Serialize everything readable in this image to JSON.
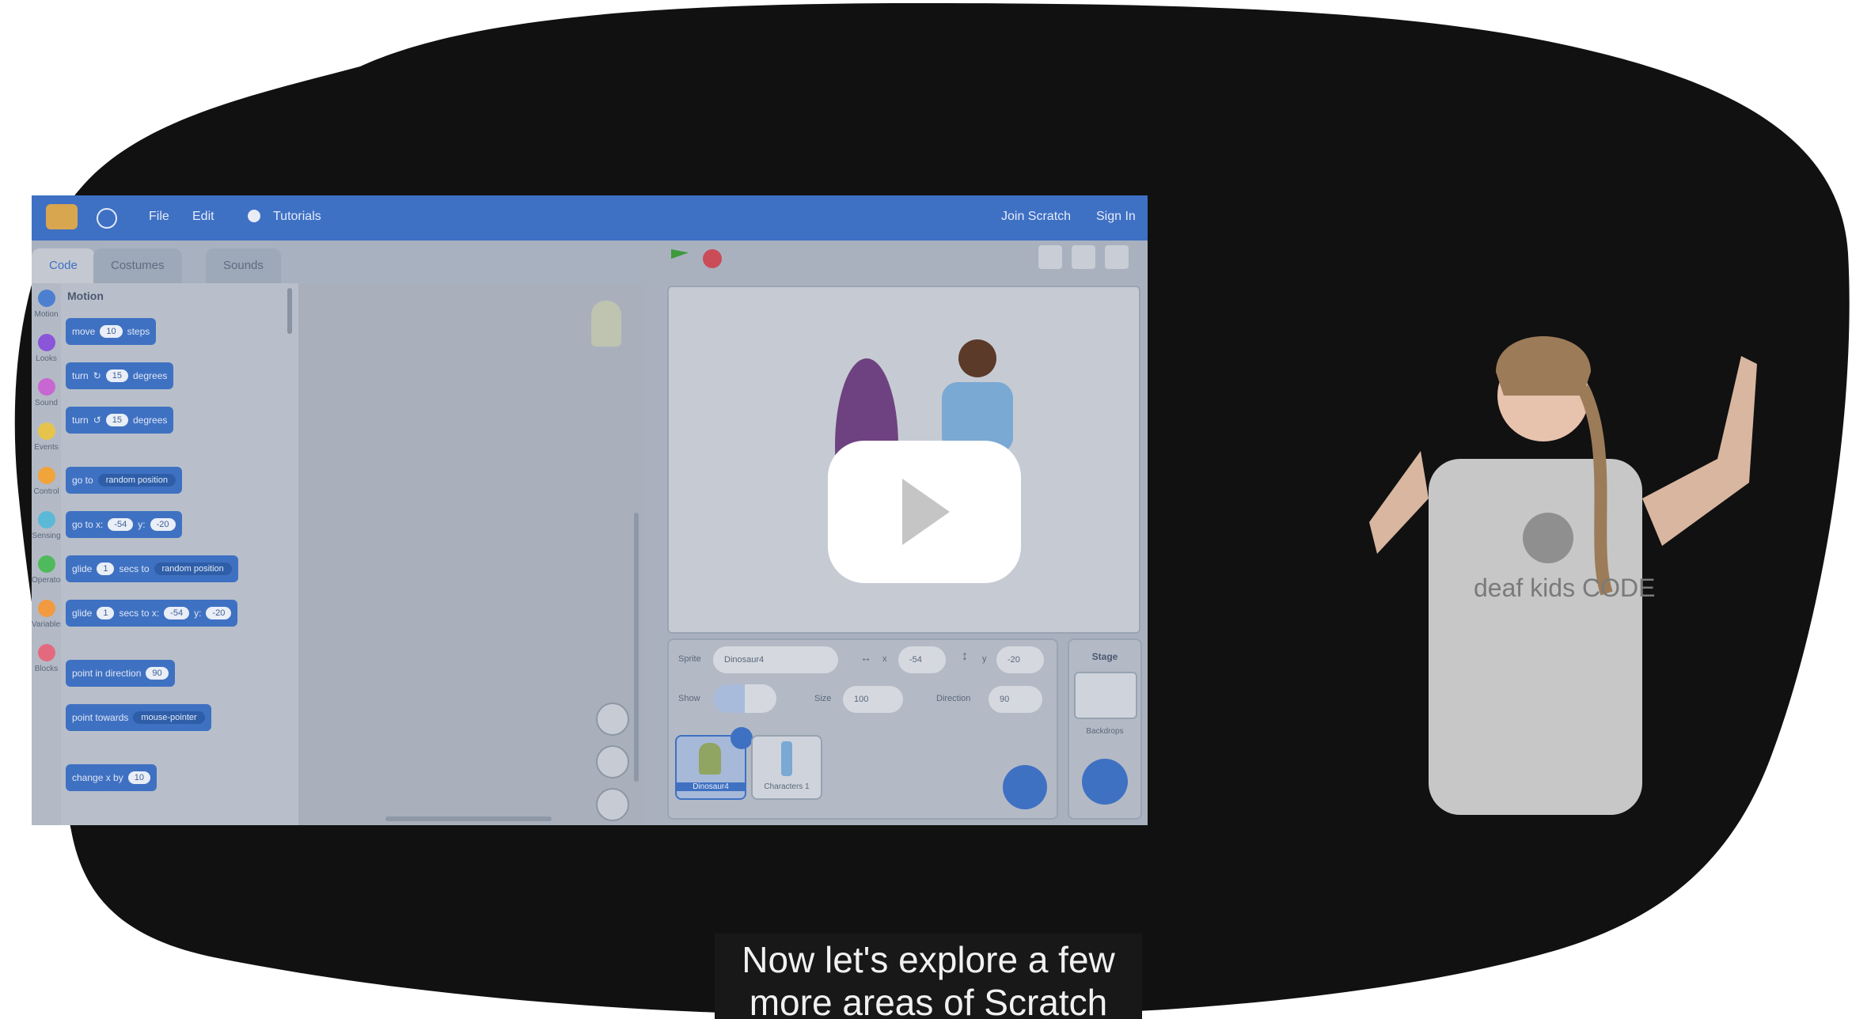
{
  "menubar": {
    "items": [
      "File",
      "Edit",
      "Tutorials"
    ],
    "right_items": [
      "Join Scratch",
      "Sign In"
    ]
  },
  "tabs": [
    {
      "label": "Code"
    },
    {
      "label": "Costumes"
    },
    {
      "label": "Sounds"
    }
  ],
  "categories": [
    {
      "label": "Motion",
      "color": "#4c7fd0"
    },
    {
      "label": "Looks",
      "color": "#8a55d8"
    },
    {
      "label": "Sound",
      "color": "#c867d1"
    },
    {
      "label": "Events",
      "color": "#e6c44c"
    },
    {
      "label": "Control",
      "color": "#f0a43a"
    },
    {
      "label": "Sensing",
      "color": "#5bb9d7"
    },
    {
      "label": "Operators",
      "color": "#4fba5b"
    },
    {
      "label": "Variables",
      "color": "#f29a3f"
    },
    {
      "label": "Blocks",
      "color": "#e36a7e"
    }
  ],
  "palette": {
    "title": "Motion",
    "blocks": [
      {
        "text": "move",
        "value": "10",
        "suffix": "steps"
      },
      {
        "text": "turn",
        "value": "15",
        "suffix": "degrees"
      },
      {
        "text": "turn",
        "value": "15",
        "suffix": "degrees"
      },
      {
        "text": "go to",
        "dropdown": "random position"
      },
      {
        "text": "go to x:",
        "x": "-54",
        "y": "-20"
      },
      {
        "text": "glide",
        "value": "1",
        "suffix": "secs to",
        "dropdown": "random position"
      },
      {
        "text": "glide",
        "value": "1",
        "suffix": "secs to x:",
        "x": "-54",
        "y": "-20"
      },
      {
        "text": "point in direction",
        "value": "90"
      },
      {
        "text": "point towards",
        "dropdown": "mouse-pointer"
      },
      {
        "text": "change x by",
        "value": "10"
      }
    ]
  },
  "sprite_info": {
    "sprite_label": "Sprite",
    "sprite_name": "Dinosaur4",
    "x_label": "x",
    "x": "-54",
    "y_label": "y",
    "y": "-20",
    "show_label": "Show",
    "size_label": "Size",
    "size": "100",
    "direction_label": "Direction",
    "direction": "90"
  },
  "sprites": [
    {
      "name": "Dinosaur4"
    },
    {
      "name": "Characters 1"
    }
  ],
  "stage_panel": {
    "title": "Stage",
    "backdrops": "Backdrops"
  },
  "caption": {
    "line1": "Now let's explore a few",
    "line2": "more areas of Scratch"
  },
  "shirt_text": "deaf kids CODE",
  "colors": {
    "menubar": "#3e70c4",
    "interpreter_bg": "#111111",
    "caption_bg": "#181818"
  }
}
